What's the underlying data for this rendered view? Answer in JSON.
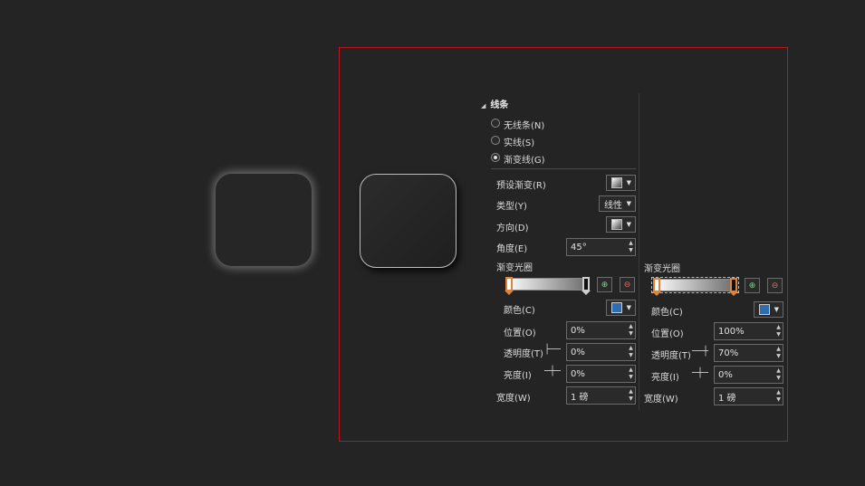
{
  "section": {
    "title": "线条"
  },
  "line_options": [
    {
      "label": "无线条(N)",
      "selected": false
    },
    {
      "label": "实线(S)",
      "selected": false
    },
    {
      "label": "渐变线(G)",
      "selected": true
    }
  ],
  "left_panel": {
    "preset_label": "预设渐变(R)",
    "type_label": "类型(Y)",
    "type_value": "线性",
    "direction_label": "方向(D)",
    "angle_label": "角度(E)",
    "angle_value": "45°",
    "stops_label": "渐变光圈",
    "color_label": "颜色(C)",
    "position_label": "位置(O)",
    "position_value": "0%",
    "transparency_label": "透明度(T)",
    "transparency_value": "0%",
    "brightness_label": "亮度(I)",
    "brightness_value": "0%",
    "width_label": "宽度(W)",
    "width_value": "1 磅"
  },
  "right_panel": {
    "stops_label": "渐变光圈",
    "color_label": "颜色(C)",
    "position_label": "位置(O)",
    "position_value": "100%",
    "transparency_label": "透明度(T)",
    "transparency_value": "70%",
    "brightness_label": "亮度(I)",
    "brightness_value": "0%",
    "width_label": "宽度(W)",
    "width_value": "1 磅"
  },
  "icons": {
    "add_stop": "add-gradient-stop-icon",
    "remove_stop": "remove-gradient-stop-icon",
    "dropdown": "chevron-down-icon",
    "spinner": "spinner-arrows-icon"
  },
  "colors": {
    "background": "#242424",
    "frame": "#c0141b",
    "stop_accent": "#e0833a",
    "color_swatch": "#2e6eb0"
  }
}
